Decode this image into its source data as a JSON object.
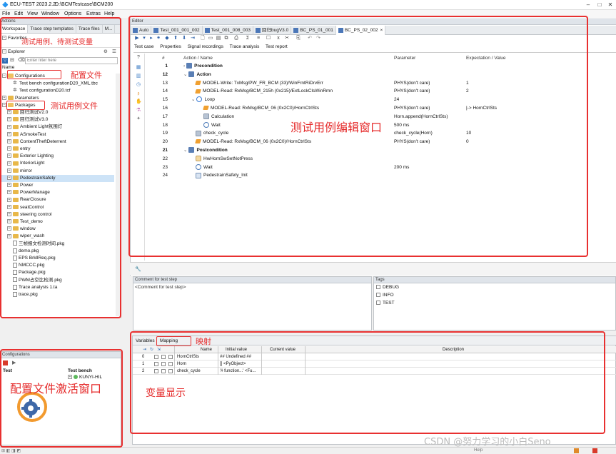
{
  "window": {
    "title": "ECU-TEST 2023.2.2",
    "path": "D:\\BCMTestcase\\BCM200"
  },
  "menu": [
    "File",
    "Edit",
    "View",
    "Window",
    "Options",
    "Extras",
    "Help"
  ],
  "left": {
    "actions_header": "Actions",
    "tabs": [
      "Workspace",
      "Trace step templates",
      "Trace files",
      "M..."
    ],
    "favorites": "Favorites",
    "explorer": "Explorer",
    "filter_placeholder": "Enter filter here",
    "name_header": "Name",
    "tree": [
      {
        "label": "Configurations",
        "kind": "folder-open",
        "level": 0,
        "expander": "-"
      },
      {
        "label": "Test bench configurationD20_XML.tbc",
        "kind": "tbc",
        "level": 1,
        "expander": ""
      },
      {
        "label": "Test configurationD20.tcf",
        "kind": "tcf",
        "level": 1,
        "expander": ""
      },
      {
        "label": "Parameters",
        "kind": "folder",
        "level": 0,
        "expander": "+"
      },
      {
        "label": "Packages",
        "kind": "folder-open",
        "level": 0,
        "expander": "-"
      },
      {
        "label": "回归测试V2.0",
        "kind": "folder",
        "level": 1,
        "expander": "+"
      },
      {
        "label": "回归测试V3.0",
        "kind": "folder",
        "level": 1,
        "expander": "+"
      },
      {
        "label": "Ambient Light氛围灯",
        "kind": "folder",
        "level": 1,
        "expander": "+"
      },
      {
        "label": "ASmokeTest",
        "kind": "folder",
        "level": 1,
        "expander": "+"
      },
      {
        "label": "ContentTheftDeterrent",
        "kind": "folder",
        "level": 1,
        "expander": "+"
      },
      {
        "label": "entry",
        "kind": "folder",
        "level": 1,
        "expander": "+"
      },
      {
        "label": "Exterior Lighting",
        "kind": "folder",
        "level": 1,
        "expander": "+"
      },
      {
        "label": "InteriorLight",
        "kind": "folder",
        "level": 1,
        "expander": "+"
      },
      {
        "label": "mirror",
        "kind": "folder",
        "level": 1,
        "expander": "+"
      },
      {
        "label": "PedestrainSafety",
        "kind": "folder",
        "level": 1,
        "expander": "+",
        "selected": true
      },
      {
        "label": "Power",
        "kind": "folder",
        "level": 1,
        "expander": "+"
      },
      {
        "label": "PowerManage",
        "kind": "folder",
        "level": 1,
        "expander": "+"
      },
      {
        "label": "RearClosure",
        "kind": "folder",
        "level": 1,
        "expander": "+"
      },
      {
        "label": "seatControl",
        "kind": "folder",
        "level": 1,
        "expander": "+"
      },
      {
        "label": "steering control",
        "kind": "folder",
        "level": 1,
        "expander": "+"
      },
      {
        "label": "Test_demo",
        "kind": "folder",
        "level": 1,
        "expander": "+"
      },
      {
        "label": "window",
        "kind": "folder",
        "level": 1,
        "expander": "+"
      },
      {
        "label": "wiper_wash",
        "kind": "folder",
        "level": 1,
        "expander": "+"
      },
      {
        "label": "三帧报文检测时间.pkg",
        "kind": "pkg",
        "level": 1,
        "expander": ""
      },
      {
        "label": "demo.pkg",
        "kind": "pkg",
        "level": 1,
        "expander": ""
      },
      {
        "label": "EPS BrkllReq.pkg",
        "kind": "pkg",
        "level": 1,
        "expander": ""
      },
      {
        "label": "NMCCC.pkg",
        "kind": "pkg",
        "level": 1,
        "expander": ""
      },
      {
        "label": "Package.pkg",
        "kind": "pkg",
        "level": 1,
        "expander": ""
      },
      {
        "label": "PWM占空比检测.pkg",
        "kind": "pkg",
        "level": 1,
        "expander": ""
      },
      {
        "label": "Trace analysis 1.ta",
        "kind": "pkg",
        "level": 1,
        "expander": ""
      },
      {
        "label": "trace.pkg",
        "kind": "pkg",
        "level": 1,
        "expander": ""
      }
    ]
  },
  "configurations": {
    "header": "Configurations",
    "col_test": "Test",
    "col_bench": "Test bench",
    "bench_item": "KUNYI-HIL"
  },
  "editor": {
    "header": "Editor",
    "tabs": [
      "Auto",
      "Test_001_001_002",
      "Test_001_008_003",
      "回归bugV3.0",
      "BC_PS_01_001",
      "BC_PS_02_002"
    ],
    "subtabs": [
      "Test case",
      "Properties",
      "Signal recordings",
      "Trace analysis",
      "Test report"
    ],
    "columns": {
      "num": "#",
      "action": "Action / Name",
      "param": "Parameter",
      "expect": "Expectation / Value"
    },
    "rows": [
      {
        "n": "1",
        "indent": 0,
        "icon": "block",
        "label": "Precondition",
        "bold": true,
        "toggle": ">",
        "param": "",
        "exp": ""
      },
      {
        "n": "12",
        "indent": 0,
        "icon": "block",
        "label": "Action",
        "bold": true,
        "toggle": "v",
        "param": "",
        "exp": ""
      },
      {
        "n": "13",
        "indent": 1,
        "icon": "model",
        "label": "MODEL-Write: TxMsg/PW_FR_BCM (33)/WinFrntRiDrvErr",
        "bold": false,
        "toggle": "",
        "param": "PHYS(don't care)",
        "exp": "1"
      },
      {
        "n": "14",
        "indent": 1,
        "icon": "model",
        "label": "MODEL-Read: RxMsg/BCM_215h (0x215)/ExtLockClsWinRmn",
        "bold": false,
        "toggle": "",
        "param": "PHYS(don't care)",
        "exp": "2"
      },
      {
        "n": "15",
        "indent": 1,
        "icon": "loop",
        "label": "Loop",
        "bold": false,
        "toggle": "v",
        "param": "24",
        "exp": ""
      },
      {
        "n": "16",
        "indent": 2,
        "icon": "model",
        "label": "MODEL-Read: RxMsg/BCM_06 (0x2C0)/HornCtrlSts",
        "bold": false,
        "toggle": "",
        "param": "PHYS(don't care)",
        "exp": "|-> HornCtrlSts"
      },
      {
        "n": "17",
        "indent": 2,
        "icon": "calc",
        "label": "Calculation",
        "bold": false,
        "toggle": "",
        "param": "Horn.append(HornCtrlSts)",
        "exp": ""
      },
      {
        "n": "18",
        "indent": 2,
        "icon": "wait",
        "label": "Wait",
        "bold": false,
        "toggle": "",
        "param": "500 ms",
        "exp": ""
      },
      {
        "n": "19",
        "indent": 1,
        "icon": "calc",
        "label": "check_cycle",
        "bold": false,
        "toggle": "",
        "param": "check_cycle(Horn)",
        "exp": "10"
      },
      {
        "n": "20",
        "indent": 1,
        "icon": "model",
        "label": "MODEL-Read: RxMsg/BCM_06 (0x2C0)/HornCtrlSts",
        "bold": false,
        "toggle": "",
        "param": "PHYS(don't care)",
        "exp": "0"
      },
      {
        "n": "21",
        "indent": 0,
        "icon": "block",
        "label": "Postcondition",
        "bold": true,
        "toggle": "v",
        "param": "",
        "exp": ""
      },
      {
        "n": "22",
        "indent": 1,
        "icon": "hand",
        "label": "HwHornSwSetNotPress",
        "bold": false,
        "toggle": "",
        "param": "",
        "exp": ""
      },
      {
        "n": "23",
        "indent": 1,
        "icon": "wait",
        "label": "Wait",
        "bold": false,
        "toggle": "",
        "param": "200 ms",
        "exp": ""
      },
      {
        "n": "24",
        "indent": 1,
        "icon": "pkg",
        "label": "PedestrainSafety_Init",
        "bold": false,
        "toggle": "",
        "param": "",
        "exp": ""
      }
    ]
  },
  "comment": {
    "header": "Comment for test step",
    "placeholder": "<Comment for test step>"
  },
  "tags": {
    "header": "Tags",
    "items": [
      "DEBUG",
      "INFO",
      "TEST"
    ]
  },
  "variables": {
    "tabs": [
      "Variables",
      "Mapping"
    ],
    "columns": [
      "Name",
      "Initial value",
      "Current value",
      "Description"
    ],
    "rows": [
      {
        "idx": "0",
        "name": "HornCtrlSts",
        "init": "## Undefined ##",
        "cur": "",
        "desc": ""
      },
      {
        "idx": "1",
        "name": "Horn",
        "init": "[] <PyObject>",
        "cur": "",
        "desc": ""
      },
      {
        "idx": "2",
        "name": "check_cycle",
        "init": "'# function...' <Fu...",
        "cur": "",
        "desc": ""
      }
    ]
  },
  "annotations": {
    "testcase_pending": "测试用例、待测试变量",
    "config_file": "配置文件",
    "testcase_file": "测试用例文件",
    "editor_window": "测试用例编辑窗口",
    "mapping": "映射",
    "config_activate": "配置文件激活窗口",
    "var_display": "变量显示"
  },
  "statusbar": {
    "help": "Help"
  },
  "watermark": "CSDN @努力学习的小白Seno",
  "colors": {
    "highlight_red": "#e83030",
    "selected_row": "#cde3f7",
    "folder": "#e8b84a"
  }
}
